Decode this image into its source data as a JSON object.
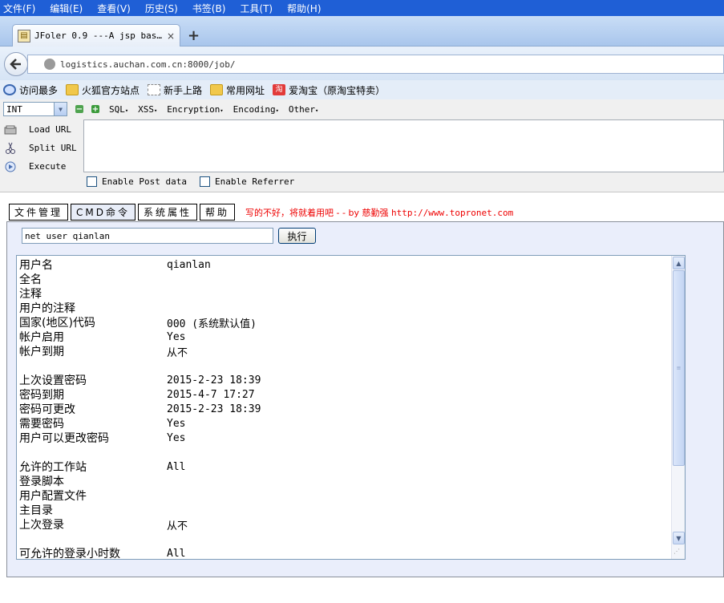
{
  "menubar": {
    "items": [
      "文件(F)",
      "编辑(E)",
      "查看(V)",
      "历史(S)",
      "书签(B)",
      "工具(T)",
      "帮助(H)"
    ]
  },
  "tab": {
    "title": "JFoler 0.9 ---A jsp bas…",
    "close": "×",
    "new_tab": "+"
  },
  "navbar": {
    "url": "logistics.auchan.com.cn:8000/job/"
  },
  "bookmarks": {
    "items": [
      {
        "label": "访问最多",
        "icon": "most-visited-icon"
      },
      {
        "label": "火狐官方站点",
        "icon": "folder-icon"
      },
      {
        "label": "新手上路",
        "icon": "dotted-page-icon"
      },
      {
        "label": "常用网址",
        "icon": "folder-icon"
      },
      {
        "label": "爱淘宝（原淘宝特卖）",
        "icon": "taobao-icon"
      }
    ]
  },
  "hackbar": {
    "select_value": "INT",
    "menus": [
      "SQL",
      "XSS",
      "Encryption",
      "Encoding",
      "Other"
    ],
    "actions": [
      "Load URL",
      "Split URL",
      "Execute"
    ],
    "enable_post": "Enable Post data",
    "enable_referrer": "Enable Referrer"
  },
  "jfolder": {
    "tabs": [
      "文件管理",
      "CMD命令",
      "系统属性",
      "帮助"
    ],
    "credit_text": "写的不好，将就着用吧 - - by 慈勤强 ",
    "credit_url": "http://www.topronet.com",
    "command": "net user qianlan",
    "exec_label": "执行",
    "output": [
      {
        "k": "用户名",
        "v": "qianlan"
      },
      {
        "k": "全名",
        "v": ""
      },
      {
        "k": "注释",
        "v": ""
      },
      {
        "k": "用户的注释",
        "v": ""
      },
      {
        "k": "国家(地区)代码",
        "v": "000 (系统默认值)"
      },
      {
        "k": "帐户启用",
        "v": "Yes"
      },
      {
        "k": "帐户到期",
        "v": "从不"
      },
      {
        "k": "",
        "v": ""
      },
      {
        "k": "上次设置密码",
        "v": "2015-2-23 18:39"
      },
      {
        "k": "密码到期",
        "v": "2015-4-7 17:27"
      },
      {
        "k": "密码可更改",
        "v": "2015-2-23 18:39"
      },
      {
        "k": "需要密码",
        "v": "Yes"
      },
      {
        "k": "用户可以更改密码",
        "v": "Yes"
      },
      {
        "k": "",
        "v": ""
      },
      {
        "k": "允许的工作站",
        "v": "All"
      },
      {
        "k": "登录脚本",
        "v": ""
      },
      {
        "k": "用户配置文件",
        "v": ""
      },
      {
        "k": "主目录",
        "v": ""
      },
      {
        "k": "上次登录",
        "v": "从不"
      },
      {
        "k": "",
        "v": ""
      },
      {
        "k": "可允许的登录小时数",
        "v": "All"
      }
    ]
  }
}
